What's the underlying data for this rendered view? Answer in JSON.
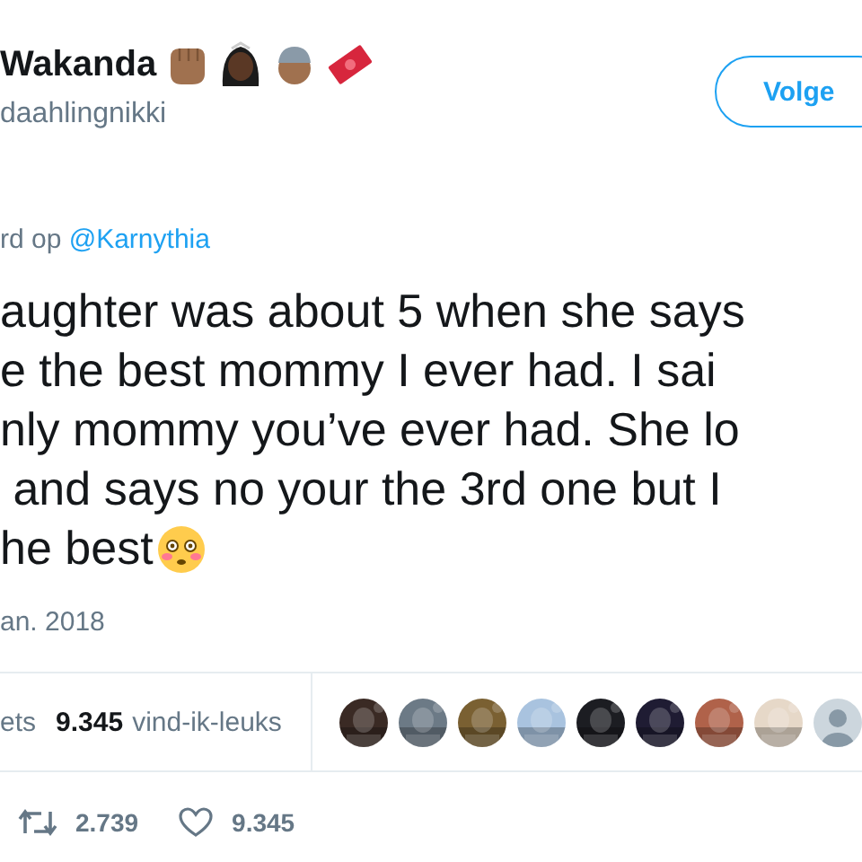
{
  "author": {
    "name": "Wakanda",
    "handle": "daahlingnikki"
  },
  "follow_button": {
    "label": "Volge"
  },
  "reply_to": {
    "prefix": "rd op ",
    "mention": "@Karnythia"
  },
  "tweet_lines": [
    "aughter was about 5 when she says",
    "e the best mommy I ever had. I sai",
    "nly mommy you’ve ever had. She lo",
    " and says no your the 3rd one but I",
    "he best"
  ],
  "date": "an. 2018",
  "stats": {
    "retweets_label": "ets",
    "likes_count": "9.345",
    "likes_label": "vind-ik-leuks"
  },
  "liker_avatars": [
    {
      "kind": "picture"
    },
    {
      "kind": "picture"
    },
    {
      "kind": "picture"
    },
    {
      "kind": "picture"
    },
    {
      "kind": "picture"
    },
    {
      "kind": "picture"
    },
    {
      "kind": "picture"
    },
    {
      "kind": "picture"
    },
    {
      "kind": "default"
    }
  ],
  "actions": {
    "retweets": "2.739",
    "likes": "9.345"
  }
}
